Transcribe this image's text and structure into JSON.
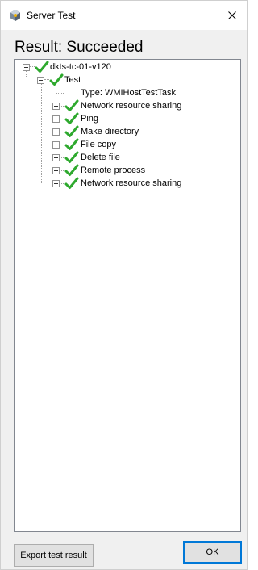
{
  "window": {
    "title": "Server Test"
  },
  "result": {
    "heading": "Result: Succeeded"
  },
  "tree": {
    "root": {
      "label": "dkts-tc-01-v120",
      "status": "success"
    },
    "test": {
      "label": "Test",
      "status": "success"
    },
    "type_label": "Type: WMIHostTestTask",
    "checks": [
      {
        "label": "Network resource sharing",
        "status": "success"
      },
      {
        "label": "Ping",
        "status": "success"
      },
      {
        "label": "Make directory",
        "status": "success"
      },
      {
        "label": "File copy",
        "status": "success"
      },
      {
        "label": "Delete file",
        "status": "success"
      },
      {
        "label": "Remote process",
        "status": "success"
      },
      {
        "label": "Network resource sharing",
        "status": "success"
      }
    ]
  },
  "buttons": {
    "export_label": "Export test result",
    "ok_label": "OK"
  },
  "colors": {
    "check_green": "#2ea92e",
    "dialog_background": "#f0f0f0",
    "default_button_border": "#0078d7"
  },
  "icons": {
    "app": "server-test-app-icon",
    "close": "close-icon",
    "status_success": "green-checkmark-icon"
  }
}
